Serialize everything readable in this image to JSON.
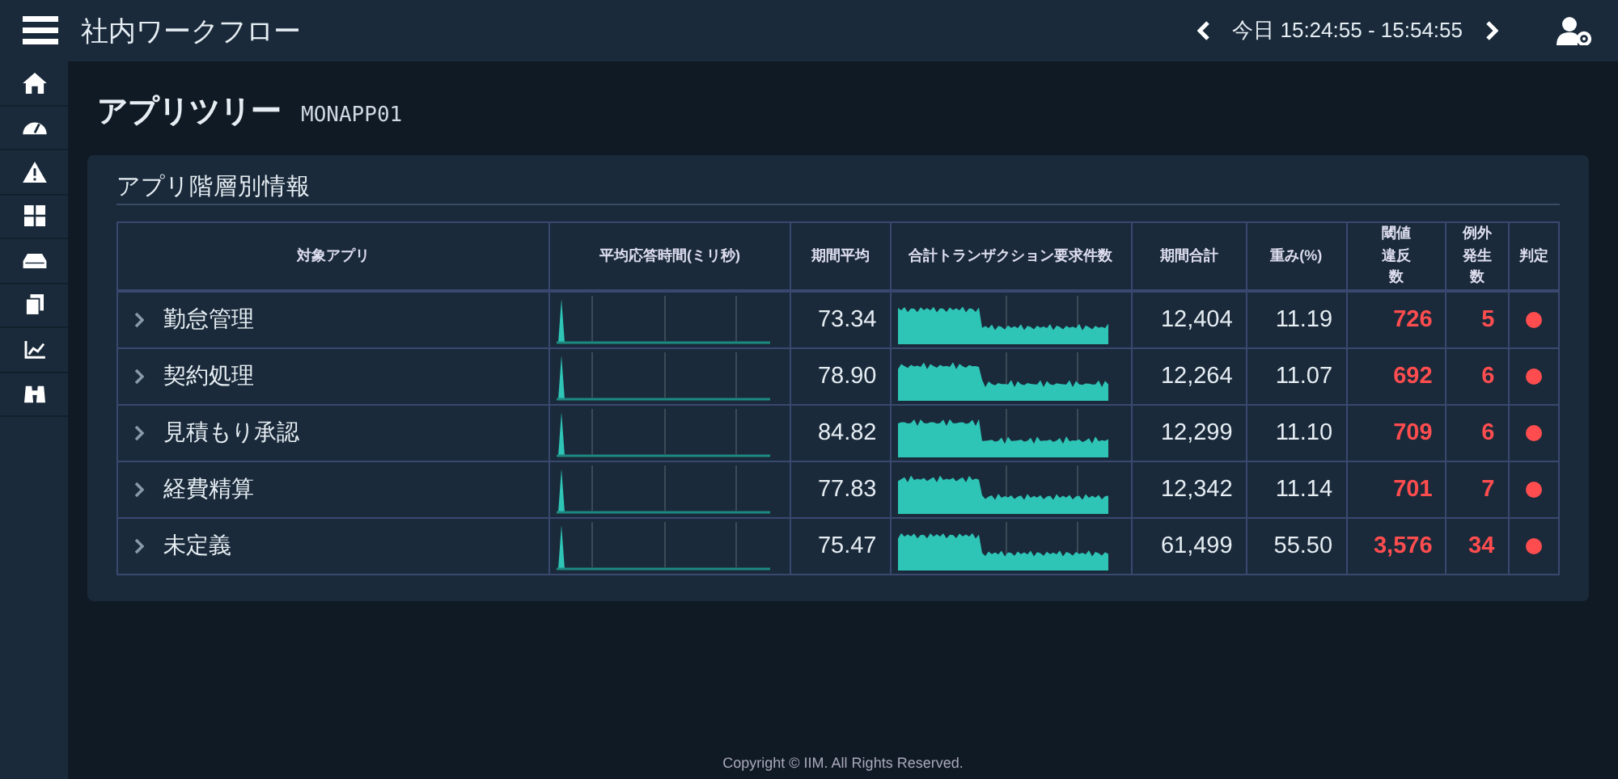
{
  "header": {
    "title": "社内ワークフロー",
    "time_range": "今日 15:24:55 - 15:54:55"
  },
  "page": {
    "title": "アプリツリー",
    "subtitle": "MONAPP01"
  },
  "panel": {
    "title": "アプリ階層別情報",
    "table": {
      "columns": [
        "対象アプリ",
        "平均応答時間(ミリ秒)",
        "期間平均",
        "合計トランザクション要求件数",
        "期間合計",
        "重み(%)",
        "閾値違反数",
        "例外発生数",
        "判定"
      ],
      "rows": [
        {
          "name": "勤怠管理",
          "expanded": false,
          "avg": "73.34",
          "total": "12,404",
          "weight": "11.19",
          "violations": "726",
          "exceptions": "5",
          "color": "#ff4d4f"
        },
        {
          "name": "契約処理",
          "expanded": false,
          "avg": "78.90",
          "total": "12,264",
          "weight": "11.07",
          "violations": "692",
          "exceptions": "6",
          "color": "#ff4d4f"
        },
        {
          "name": "見積もり承認",
          "expanded": false,
          "avg": "84.82",
          "total": "12,299",
          "weight": "11.10",
          "violations": "709",
          "exceptions": "6",
          "color": "#ff4d4f"
        },
        {
          "name": "経費精算",
          "expanded": false,
          "avg": "77.83",
          "total": "12,342",
          "weight": "11.14",
          "violations": "701",
          "exceptions": "7",
          "color": "#ff4d4f"
        },
        {
          "name": "未定義",
          "expanded": false,
          "avg": "75.47",
          "total": "61,499",
          "weight": "55.50",
          "violations": "3,576",
          "exceptions": "34",
          "color": "#ff4d4f"
        }
      ]
    }
  },
  "footer": {
    "copyright": "Copyright © IIM. All Rights Reserved."
  }
}
